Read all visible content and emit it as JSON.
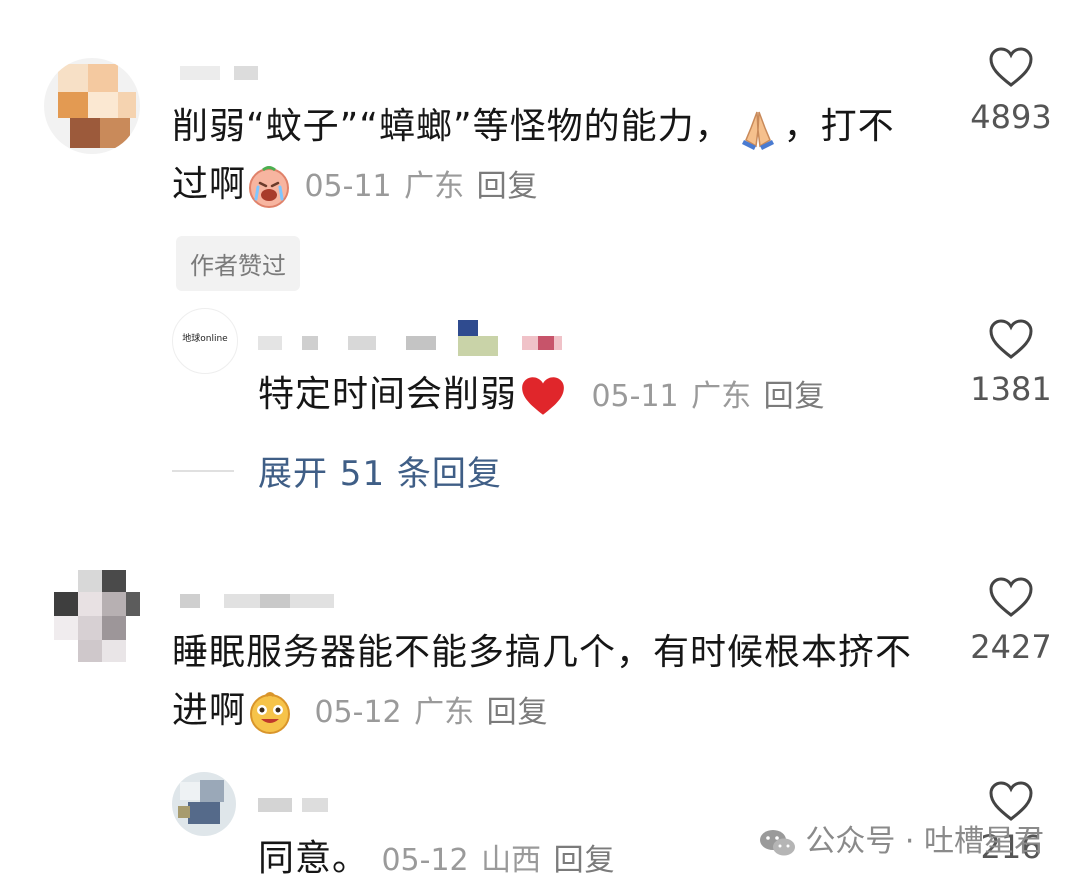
{
  "comments": [
    {
      "text": "削弱“蚊子”“蟑螂”等怪物的能力，",
      "text_tail": "，打不",
      "text_line2": "过啊",
      "date": "05-11",
      "region": "广东",
      "reply_label": "回复",
      "likes": "4893",
      "badge": "作者赞过"
    },
    {
      "text": "特定时间会削弱",
      "date": "05-11",
      "region": "广东",
      "reply_label": "回复",
      "likes": "1381",
      "avatar_text": "地球online"
    },
    {
      "expand_label": "展开 51 条回复"
    },
    {
      "text": "睡眠服务器能不能多搞几个，有时候根本挤不",
      "text_line2": "进啊",
      "date": "05-12",
      "region": "广东",
      "reply_label": "回复",
      "likes": "2427"
    },
    {
      "text": "同意。",
      "date": "05-12",
      "region": "山西",
      "reply_label": "回复",
      "likes": "216"
    }
  ],
  "watermark": {
    "label": "公众号 · 吐槽星君"
  },
  "icons": {
    "like": "heart-outline-icon",
    "pray": "folded-hands-emoji",
    "cry": "crying-face-emoji",
    "heart": "red-heart-emoji",
    "grin": "grinning-face-emoji",
    "wechat": "wechat-logo-icon"
  },
  "colors": {
    "link": "#3f5e86",
    "meta": "#9a9a9a",
    "heart": "#e0262b"
  }
}
